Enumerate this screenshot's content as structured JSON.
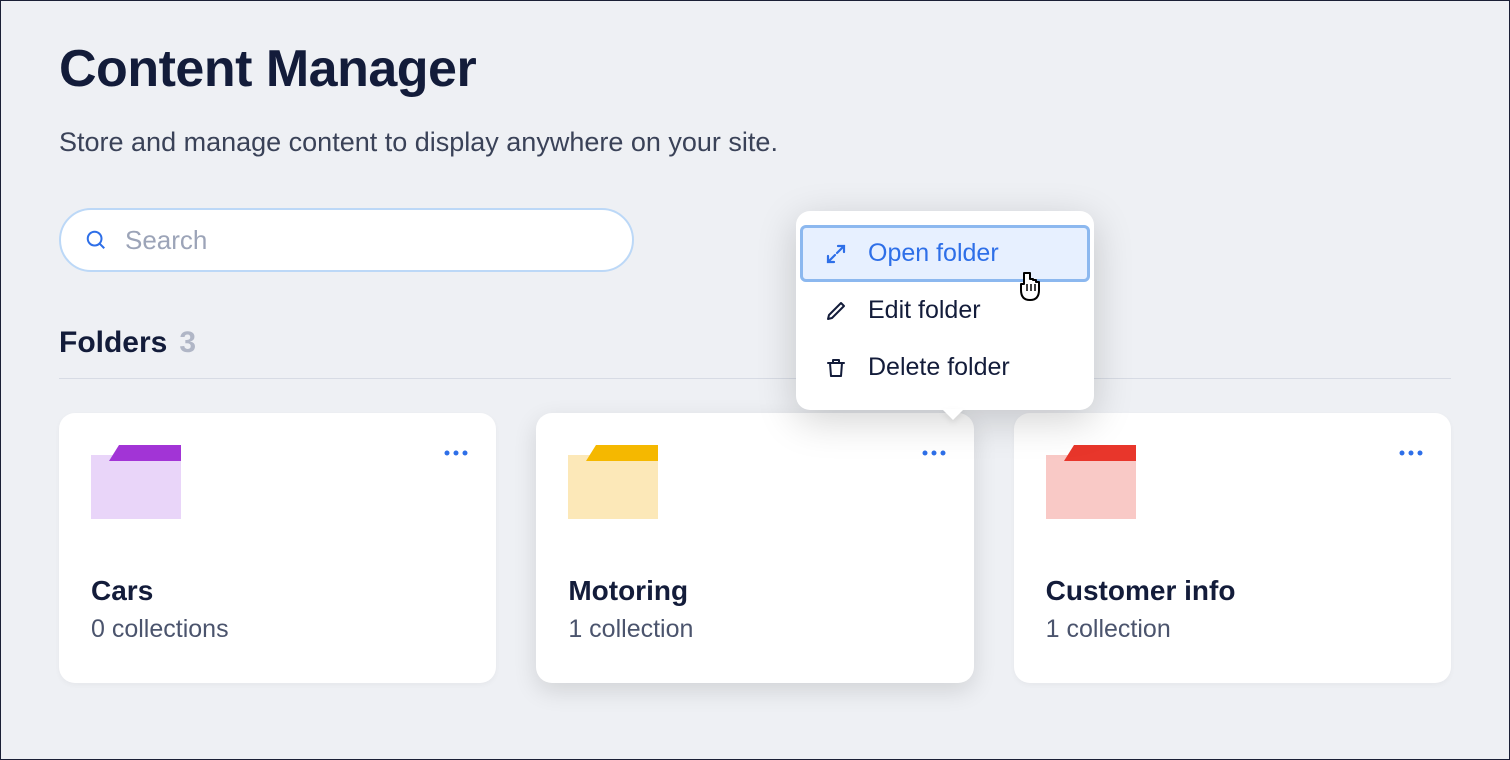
{
  "page": {
    "title": "Content Manager",
    "subtitle": "Store and manage content to display anywhere on your site."
  },
  "search": {
    "placeholder": "Search"
  },
  "folders_section": {
    "label": "Folders",
    "count": "3"
  },
  "folders": [
    {
      "name": "Cars",
      "subtitle": "0 collections",
      "color": "purple"
    },
    {
      "name": "Motoring",
      "subtitle": "1 collection",
      "color": "yellow"
    },
    {
      "name": "Customer info",
      "subtitle": "1 collection",
      "color": "red"
    }
  ],
  "context_menu": {
    "items": [
      {
        "icon": "expand-icon",
        "label": "Open folder",
        "selected": true
      },
      {
        "icon": "pencil-icon",
        "label": "Edit folder",
        "selected": false
      },
      {
        "icon": "trash-icon",
        "label": "Delete folder",
        "selected": false
      }
    ]
  }
}
